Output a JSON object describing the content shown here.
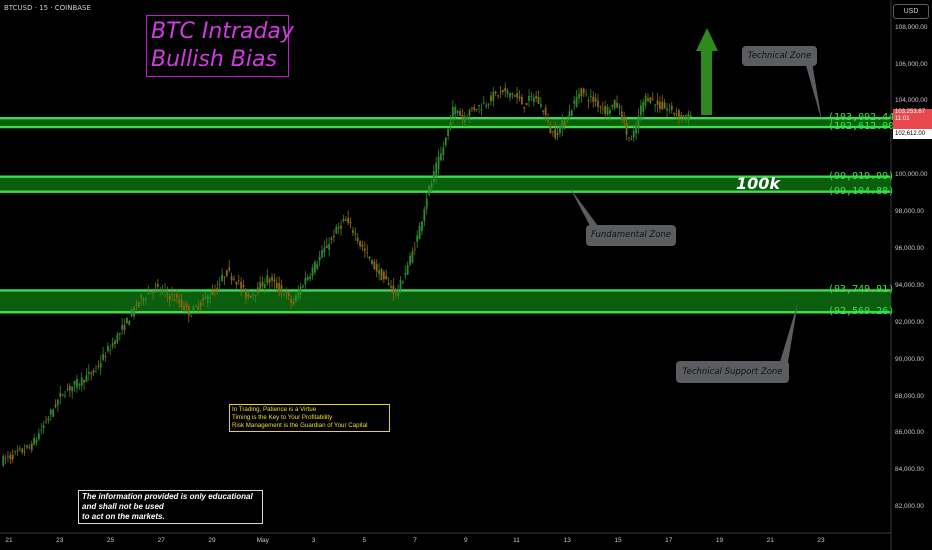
{
  "symbol_label": "BTCUSD · 15 · COINBASE",
  "currency_button": "USD",
  "headline": {
    "line1": "BTC Intraday",
    "line2": "Bullish Bias"
  },
  "big_label": "100k",
  "callouts": {
    "technical_zone": "Technical Zone",
    "fundamental_zone": "Fundamental Zone",
    "support_zone": "Technical Support Zone"
  },
  "notes": [
    "In Trading, Patience is a Virtue",
    "Timing is the Key to Your Profitability",
    "Risk Management is the Guardian of Your Capital"
  ],
  "disclaimer": [
    "The information provided is only educational",
    "and shall not be used",
    "to act on the markets."
  ],
  "price_tag": {
    "price": "103,253.87",
    "countdown": "11:01",
    "level": "102,612.00"
  },
  "colors": {
    "bg": "#000000",
    "level_line": "#3ddc4a",
    "zone_fill": "#0b5e0e",
    "candle_up": "#2e8a2e",
    "candle_down": "#8a6a12",
    "arrow": "#2e8a1c",
    "headline": "#d23be0"
  },
  "chart_data": {
    "type": "candlestick",
    "y_axis_ticks": [
      82000,
      84000,
      86000,
      88000,
      90000,
      92000,
      94000,
      96000,
      98000,
      100000,
      102000,
      104000,
      106000,
      108000
    ],
    "y_axis_labels": [
      "82,000.00",
      "84,000.00",
      "86,000.00",
      "88,000.00",
      "90,000.00",
      "92,000.00",
      "94,000.00",
      "96,000.00",
      "98,000.00",
      "100,000.00",
      "102,000.00",
      "104,000.00",
      "106,000.00",
      "108,000.00"
    ],
    "x_axis_labels": [
      "21",
      "23",
      "25",
      "27",
      "29",
      "May",
      "3",
      "5",
      "7",
      "9",
      "11",
      "13",
      "15",
      "17",
      "19",
      "21",
      "23"
    ],
    "ylim": [
      80600,
      109500
    ],
    "levels": [
      {
        "price": 103092.44,
        "label": "(103,092.44)"
      },
      {
        "price": 102612.0,
        "label": "(102,612.00)"
      },
      {
        "price": 99919.99,
        "label": "(99,919.99)"
      },
      {
        "price": 99104.88,
        "label": "(99,104.88)"
      },
      {
        "price": 93749.91,
        "label": "(93,749.91)"
      },
      {
        "price": 92569.26,
        "label": "(92,569.26)"
      }
    ],
    "zones": [
      [
        102612.0,
        103092.44
      ],
      [
        99104.88,
        99919.99
      ],
      [
        92569.26,
        93749.91
      ]
    ],
    "price_path": [
      [
        0,
        84500
      ],
      [
        3,
        85300
      ],
      [
        6,
        88200
      ],
      [
        9,
        89300
      ],
      [
        12,
        91800
      ],
      [
        13.5,
        93200
      ],
      [
        15,
        93900
      ],
      [
        17,
        93300
      ],
      [
        18.5,
        92500
      ],
      [
        19.5,
        93100
      ],
      [
        21,
        93800
      ],
      [
        22,
        94800
      ],
      [
        23,
        94300
      ],
      [
        24,
        93400
      ],
      [
        25,
        93800
      ],
      [
        26,
        94400
      ],
      [
        27.5,
        93700
      ],
      [
        28.5,
        93000
      ],
      [
        29.5,
        94200
      ],
      [
        30.5,
        95000
      ],
      [
        31.5,
        95900
      ],
      [
        32.5,
        96800
      ],
      [
        33.5,
        97600
      ],
      [
        34.5,
        96900
      ],
      [
        35,
        96300
      ],
      [
        36,
        95400
      ],
      [
        37,
        94600
      ],
      [
        38,
        94000
      ],
      [
        38.5,
        93600
      ],
      [
        39,
        94100
      ],
      [
        40,
        95600
      ],
      [
        40.5,
        96400
      ],
      [
        41,
        97500
      ],
      [
        41.5,
        98800
      ],
      [
        42,
        99600
      ],
      [
        42.5,
        100500
      ],
      [
        43,
        101200
      ],
      [
        43.6,
        102400
      ],
      [
        44,
        103500
      ],
      [
        44.5,
        103600
      ],
      [
        45,
        103100
      ],
      [
        46,
        103600
      ],
      [
        47,
        103800
      ],
      [
        48,
        104300
      ],
      [
        49,
        104500
      ],
      [
        50,
        104400
      ],
      [
        51,
        103800
      ],
      [
        52,
        104300
      ],
      [
        53,
        103500
      ],
      [
        53.5,
        102500
      ],
      [
        54,
        102200
      ],
      [
        55,
        102900
      ],
      [
        56,
        104000
      ],
      [
        56.5,
        104600
      ],
      [
        57,
        104300
      ],
      [
        58,
        104000
      ],
      [
        59,
        103500
      ],
      [
        60,
        103900
      ],
      [
        60.5,
        103400
      ],
      [
        61,
        102300
      ],
      [
        61.5,
        101800
      ],
      [
        62,
        102700
      ],
      [
        62.5,
        103800
      ],
      [
        63,
        104300
      ],
      [
        64,
        103800
      ],
      [
        65,
        103600
      ],
      [
        66,
        103300
      ],
      [
        67,
        103100
      ],
      [
        67.3,
        103250
      ]
    ]
  }
}
